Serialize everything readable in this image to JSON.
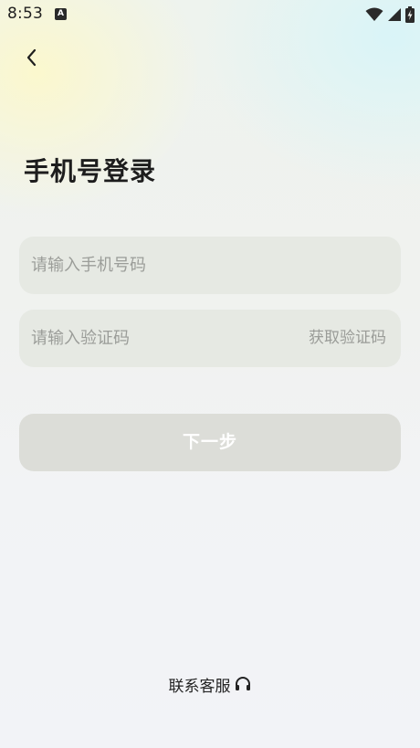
{
  "status_bar": {
    "time": "8:53",
    "notification_icon_letter": "A",
    "icons": [
      "wifi-icon",
      "signal-icon",
      "battery-charging-icon"
    ]
  },
  "header": {
    "back_icon": "chevron-left-icon"
  },
  "title": "手机号登录",
  "phone_input": {
    "placeholder": "请输入手机号码",
    "value": ""
  },
  "code_input": {
    "placeholder": "请输入验证码",
    "value": "",
    "get_code_label": "获取验证码"
  },
  "next_button": {
    "label": "下一步"
  },
  "support": {
    "label": "联系客服",
    "icon": "headset-icon"
  }
}
